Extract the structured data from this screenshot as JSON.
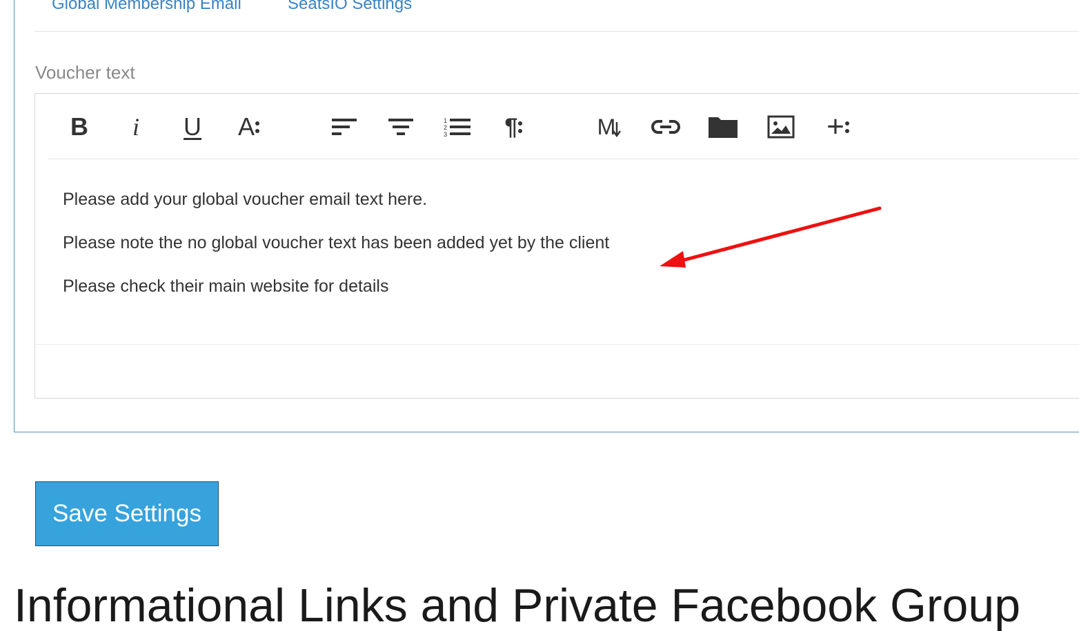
{
  "tabs": [
    {
      "label": "Global Membership Email"
    },
    {
      "label": "SeatsIO Settings"
    }
  ],
  "voucher": {
    "label": "Voucher text",
    "lines": [
      "Please add your global voucher email text here.",
      "Please note the no global voucher text has been added yet by the client",
      "Please check their main website for details"
    ]
  },
  "toolbar": {
    "buttons": [
      {
        "name": "bold-icon",
        "glyph": "B"
      },
      {
        "name": "italic-icon",
        "glyph": "i"
      },
      {
        "name": "underline-icon",
        "glyph": "U"
      },
      {
        "name": "font-size-icon",
        "glyph": "A"
      },
      {
        "name": "align-left-icon"
      },
      {
        "name": "align-center-icon"
      },
      {
        "name": "ordered-list-icon"
      },
      {
        "name": "paragraph-icon",
        "glyph": "¶"
      },
      {
        "name": "markdown-icon",
        "glyph": "M"
      },
      {
        "name": "link-icon"
      },
      {
        "name": "folder-icon"
      },
      {
        "name": "image-icon"
      },
      {
        "name": "insert-more-icon",
        "glyph": "+"
      }
    ]
  },
  "actions": {
    "save_label": "Save Settings"
  },
  "section": {
    "title": "Informational Links and Private Facebook Group"
  },
  "colors": {
    "link": "#3a83c3",
    "save_button": "#36a3dd",
    "annotation_arrow": "#ee1111"
  }
}
